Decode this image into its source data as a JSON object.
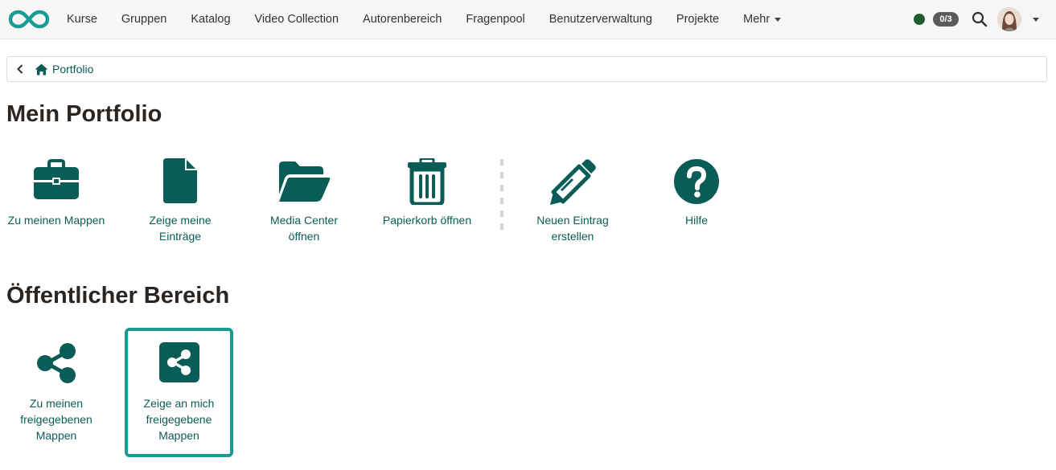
{
  "nav": {
    "items": [
      "Kurse",
      "Gruppen",
      "Katalog",
      "Video Collection",
      "Autorenbereich",
      "Fragenpool",
      "Benutzerverwaltung",
      "Projekte",
      "Mehr"
    ]
  },
  "status": {
    "badge": "0/3",
    "dot_color": "#1e5e2e"
  },
  "breadcrumb": {
    "label": "Portfolio"
  },
  "sections": {
    "portfolio_title": "Mein Portfolio",
    "public_title": "Öffentlicher Bereich"
  },
  "portfolio_tiles": [
    {
      "line1": "Zu meinen Mappen",
      "line2": "",
      "icon": "briefcase-icon"
    },
    {
      "line1": "Zeige meine",
      "line2": "Einträge",
      "icon": "file-icon"
    },
    {
      "line1": "Media Center",
      "line2": "öffnen",
      "icon": "folder-open-icon"
    },
    {
      "line1": "Papierkorb öffnen",
      "line2": "",
      "icon": "trash-icon"
    },
    {
      "line1": "Neuen Eintrag",
      "line2": "erstellen",
      "icon": "pencil-icon"
    },
    {
      "line1": "Hilfe",
      "line2": "",
      "icon": "help-icon"
    }
  ],
  "public_tiles": [
    {
      "line1": "Zu meinen",
      "line2": "freigegebenen",
      "line3": "Mappen",
      "icon": "share-icon"
    },
    {
      "line1": "Zeige an mich",
      "line2": "freigegebene",
      "line3": "Mappen",
      "icon": "share-square-icon"
    }
  ],
  "colors": {
    "accent": "#0a5c56",
    "active_border": "#1a9b93",
    "heading": "#2b2521"
  }
}
